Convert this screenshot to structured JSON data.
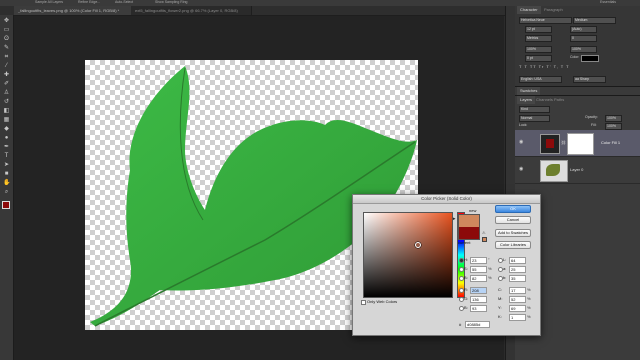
{
  "options_bar": {
    "items": [
      "",
      "Sample All Layers",
      "Refine Edge...",
      "Auto-Select",
      "Show Sampling Ring"
    ],
    "workspace": "Essentials"
  },
  "document_tabs": [
    {
      "label": "_fallingoutfits_leaves.png @ 100% (Color Fill 1, RGB/8) *",
      "active": true
    },
    {
      "label": "ext5_fallingoutfits_flower2.png @ 66.7% (Layer 0, RGB/8)",
      "active": false
    }
  ],
  "character_panel": {
    "tabs": [
      "Character",
      "Paragraph"
    ],
    "font_family": "Helvetica Neue",
    "font_style": "Medium",
    "font_size": "12 pt",
    "leading": "(Auto)",
    "kerning": "Metrics",
    "tracking": "0",
    "vertical_scale": "100%",
    "horizontal_scale": "100%",
    "baseline": "0 pt",
    "color_label": "Color:",
    "style_row": "T T TT Tr T' T, T T",
    "language": "English: USA",
    "antialias": "aa Sharp"
  },
  "swatches_panel": {
    "title": "Swatches"
  },
  "layers_panel": {
    "tabs": [
      "Layers",
      "Channels",
      "Paths"
    ],
    "kind_label": "Kind",
    "blend_mode": "Normal",
    "opacity_label": "Opacity:",
    "opacity": "100%",
    "fill_label": "Fill:",
    "fill": "100%",
    "lock_label": "Lock:",
    "layers": [
      {
        "name": "Color Fill 1",
        "selected": true
      },
      {
        "name": "Layer 0",
        "selected": false
      }
    ]
  },
  "color_picker": {
    "title": "Color Picker (Solid Color)",
    "new_label": "new",
    "current_label": "current",
    "buttons": {
      "ok": "OK",
      "cancel": "Cancel",
      "add_to_swatches": "Add to Swatches",
      "color_libraries": "Color Libraries"
    },
    "only_web_colors": "Only Web Colors",
    "hex_prefix": "#",
    "hex": "d0885d",
    "hsb": [
      {
        "label": "H:",
        "value": "23",
        "unit": "°"
      },
      {
        "label": "S:",
        "value": "55",
        "unit": "%"
      },
      {
        "label": "B:",
        "value": "82",
        "unit": "%"
      }
    ],
    "rgb": [
      {
        "label": "R:",
        "value": "208",
        "unit": ""
      },
      {
        "label": "G:",
        "value": "136",
        "unit": ""
      },
      {
        "label": "B:",
        "value": "93",
        "unit": ""
      }
    ],
    "lab": [
      {
        "label": "L:",
        "value": "64",
        "unit": ""
      },
      {
        "label": "a:",
        "value": "25",
        "unit": ""
      },
      {
        "label": "b:",
        "value": "35",
        "unit": ""
      }
    ],
    "cmyk": [
      {
        "label": "C:",
        "value": "17",
        "unit": "%"
      },
      {
        "label": "M:",
        "value": "52",
        "unit": "%"
      },
      {
        "label": "Y:",
        "value": "69",
        "unit": "%"
      },
      {
        "label": "K:",
        "value": "1",
        "unit": "%"
      }
    ],
    "new_color": "#d0885d",
    "current_color": "#8c0a0a"
  },
  "colors": {
    "foreground": "#8c0a0a",
    "background": "#ffffff",
    "leaf": "#3fae3f"
  },
  "icons": [
    "move-tool",
    "marquee-tool",
    "lasso-tool",
    "quick-select-tool",
    "crop-tool",
    "eyedropper-tool",
    "healing-tool",
    "brush-tool",
    "stamp-tool",
    "history-brush-tool",
    "eraser-tool",
    "gradient-tool",
    "blur-tool",
    "dodge-tool",
    "pen-tool",
    "type-tool",
    "path-select-tool",
    "shape-tool",
    "hand-tool",
    "zoom-tool"
  ]
}
